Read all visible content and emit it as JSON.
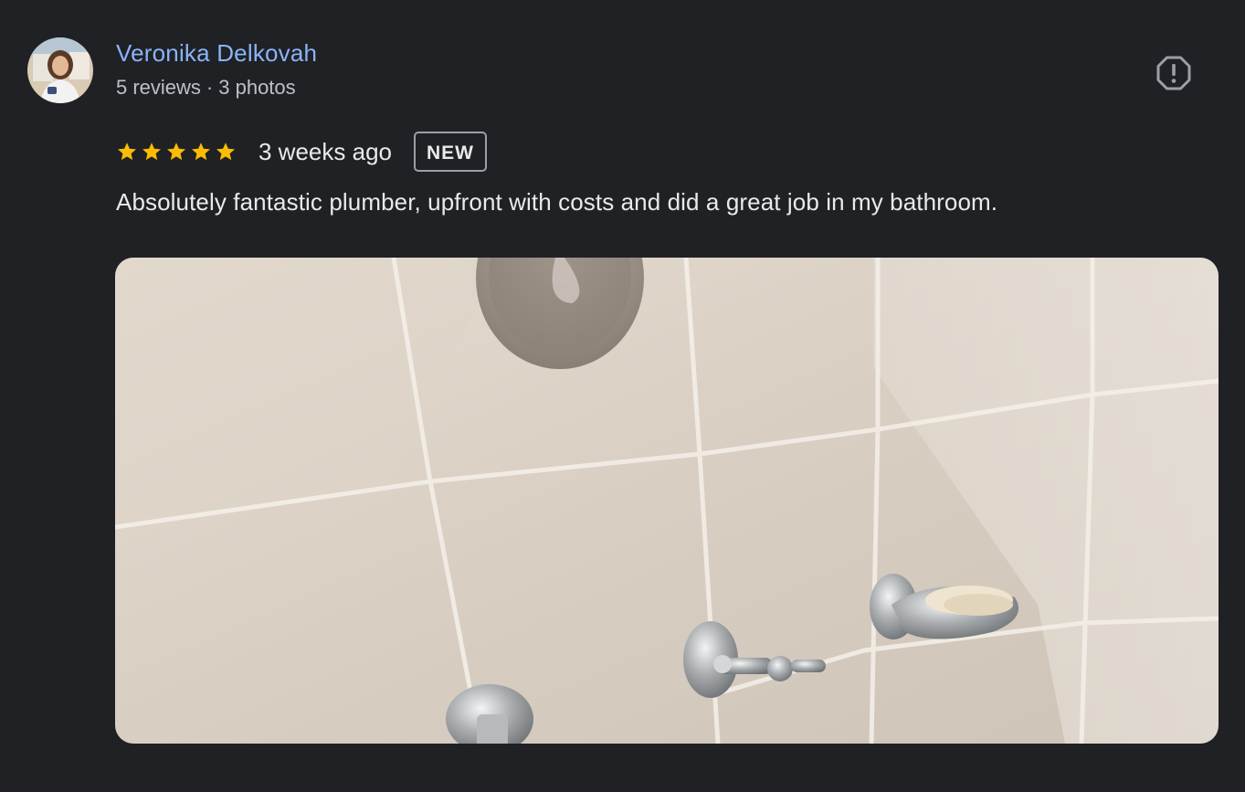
{
  "author": {
    "name": "Veronika Delkovah",
    "reviews": "5 reviews",
    "separator": "·",
    "photos": "3 photos",
    "avatar_icon": "user-avatar-photo"
  },
  "report": {
    "icon": "report-icon"
  },
  "rating": {
    "stars": 5,
    "max_stars": 5,
    "star_color": "#fbbc04",
    "time": "3 weeks ago",
    "badge": "NEW"
  },
  "review_text": "Absolutely fantastic plumber, upfront with costs and did a great job in my bathroom.",
  "photo": {
    "subject": "bathroom tiles with chrome taps and soap dish"
  },
  "colors": {
    "background": "#202124",
    "link": "#8ab4f8",
    "text": "#e8eaed",
    "muted": "#bdc1c6"
  }
}
